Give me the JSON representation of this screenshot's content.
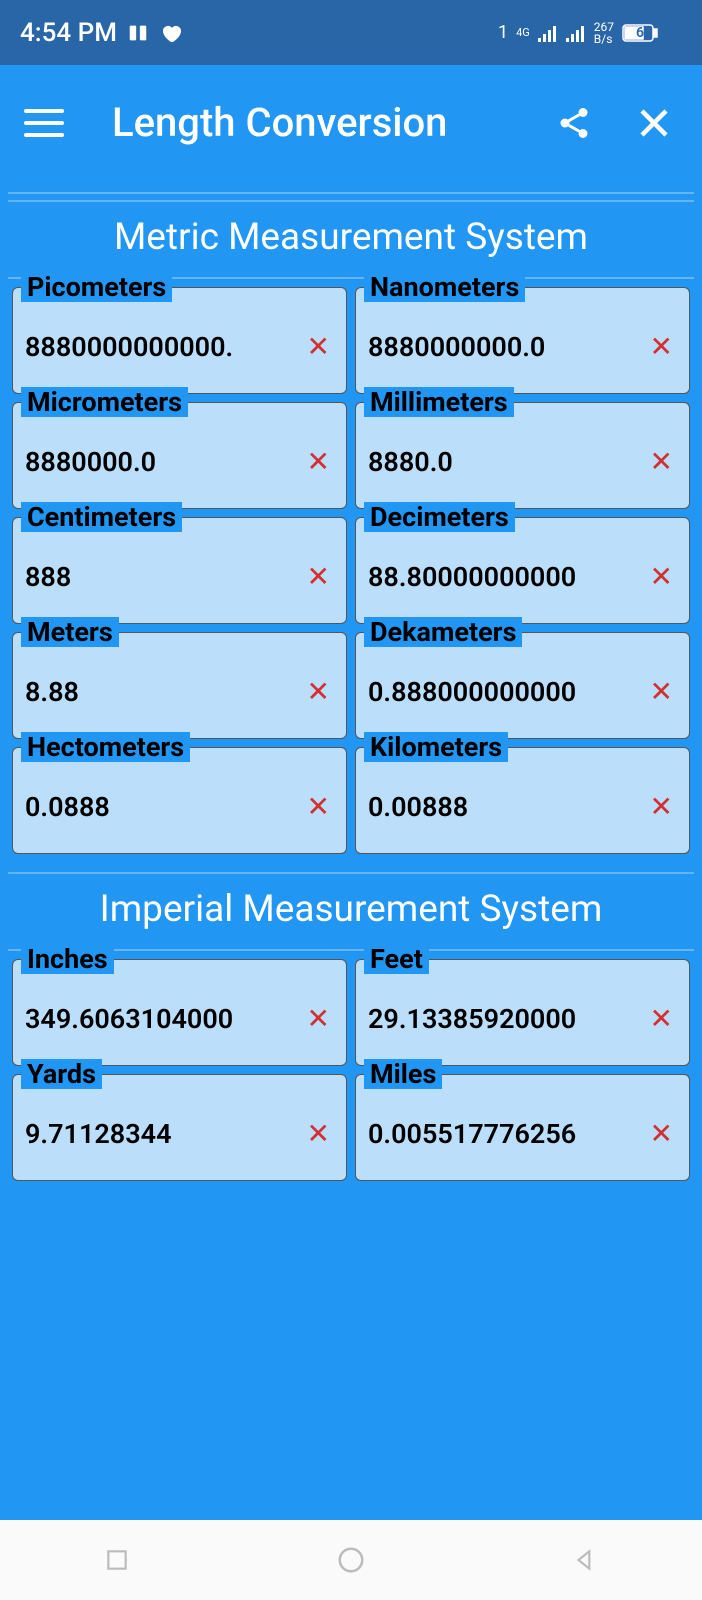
{
  "status": {
    "time": "4:54 PM",
    "network_label": "4G",
    "data_rate": "267",
    "data_unit": "B/s",
    "battery": "62"
  },
  "appbar": {
    "title": "Length Conversion"
  },
  "sections": [
    {
      "title": "Metric Measurement System",
      "fields": [
        {
          "label": "Picometers",
          "value": "8880000000000."
        },
        {
          "label": "Nanometers",
          "value": "8880000000.0"
        },
        {
          "label": "Micrometers",
          "value": "8880000.0"
        },
        {
          "label": "Millimeters",
          "value": "8880.0"
        },
        {
          "label": "Centimeters",
          "value": "888"
        },
        {
          "label": "Decimeters",
          "value": "88.80000000000"
        },
        {
          "label": "Meters",
          "value": "8.88"
        },
        {
          "label": "Dekameters",
          "value": "0.888000000000"
        },
        {
          "label": "Hectometers",
          "value": "0.0888"
        },
        {
          "label": "Kilometers",
          "value": "0.00888"
        }
      ]
    },
    {
      "title": "Imperial Measurement System",
      "fields": [
        {
          "label": "Inches",
          "value": "349.6063104000"
        },
        {
          "label": "Feet",
          "value": "29.13385920000"
        },
        {
          "label": "Yards",
          "value": "9.71128344"
        },
        {
          "label": "Miles",
          "value": "0.005517776256"
        }
      ]
    }
  ]
}
